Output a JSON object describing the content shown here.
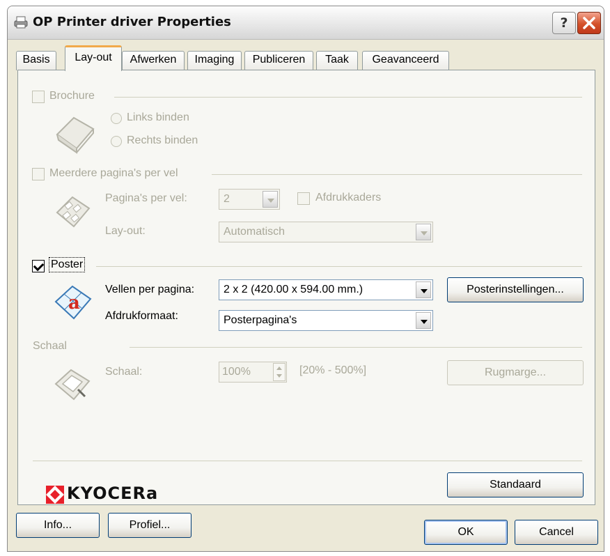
{
  "window": {
    "title": "OP Printer driver Properties",
    "help_symbol": "?"
  },
  "tabs": [
    {
      "label": "Basis",
      "active": false
    },
    {
      "label": "Lay-out",
      "active": true
    },
    {
      "label": "Afwerken",
      "active": false
    },
    {
      "label": "Imaging",
      "active": false
    },
    {
      "label": "Publiceren",
      "active": false
    },
    {
      "label": "Taak",
      "active": false
    },
    {
      "label": "Geavanceerd",
      "active": false
    }
  ],
  "brochure": {
    "label": "Brochure",
    "checked": false,
    "enabled": false,
    "options": [
      "Links binden",
      "Rechts binden"
    ]
  },
  "multipage": {
    "label": "Meerdere pagina's per vel",
    "checked": false,
    "enabled": false,
    "pages_per_sheet_label": "Pagina's per vel:",
    "pages_per_sheet_value": "2",
    "borders_label": "Afdrukkaders",
    "layout_label": "Lay-out:",
    "layout_value": "Automatisch"
  },
  "poster": {
    "label": "Poster",
    "checked": true,
    "sheets_label": "Vellen per pagina:",
    "sheets_value": "2 x 2 (420.00 x 594.00 mm.)",
    "settings_button": "Posterinstellingen...",
    "format_label": "Afdrukformaat:",
    "format_value": "Posterpagina's"
  },
  "scale": {
    "group_label": "Schaal",
    "label": "Schaal:",
    "value": "100%",
    "range": "[20% - 500%]",
    "gutter_button": "Rugmarge..."
  },
  "brand": {
    "logo_text": "KYOCERa",
    "accent": "#e8202a"
  },
  "buttons": {
    "default": "Standaard",
    "info": "Info...",
    "profile": "Profiel...",
    "ok": "OK",
    "cancel": "Cancel"
  }
}
